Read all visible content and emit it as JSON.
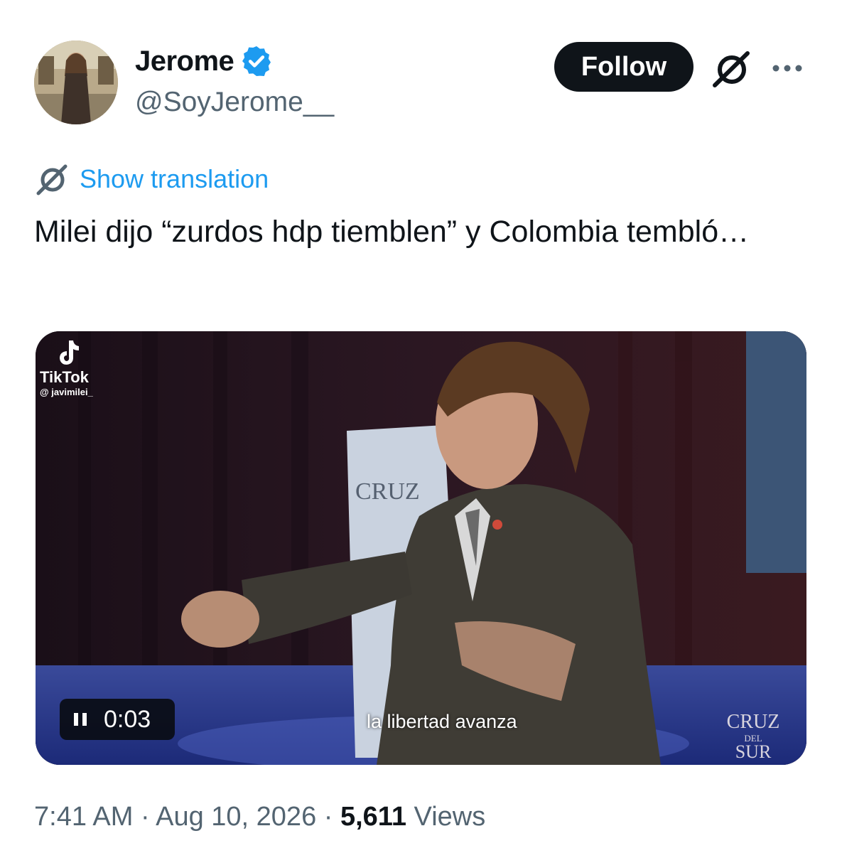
{
  "tweet": {
    "author": {
      "name": "Jerome",
      "handle": "@SoyJerome__",
      "avatar_icon": "profile-photo",
      "verified": true
    },
    "actions": {
      "follow_label": "Follow",
      "grok_icon": "slashed-circle-icon",
      "more_icon": "more-dots-icon"
    },
    "translation": {
      "label": "Show translation",
      "icon": "slashed-circle-icon"
    },
    "text": "Milei dijo “zurdos hdp tiemblen” y Colombia tembló…",
    "media": {
      "watermark_app": "TikTok",
      "watermark_user": "@ javimilei_",
      "podium_text": "CRUZ",
      "subtitle": "la libertad avanza",
      "brand_line1": "CRUZ",
      "brand_line2": "DEL",
      "brand_line3": "SUR",
      "player": {
        "time": "0:03",
        "icon": "pause-icon"
      }
    },
    "meta": {
      "time": "7:41 AM",
      "date": "Aug 10, 2026",
      "separator": "·",
      "view_count": "5,611",
      "views_label": "Views"
    }
  },
  "colors": {
    "accent": "#1d9bf0",
    "text_primary": "#0f1419",
    "text_secondary": "#536471",
    "follow_bg": "#0f1419"
  }
}
